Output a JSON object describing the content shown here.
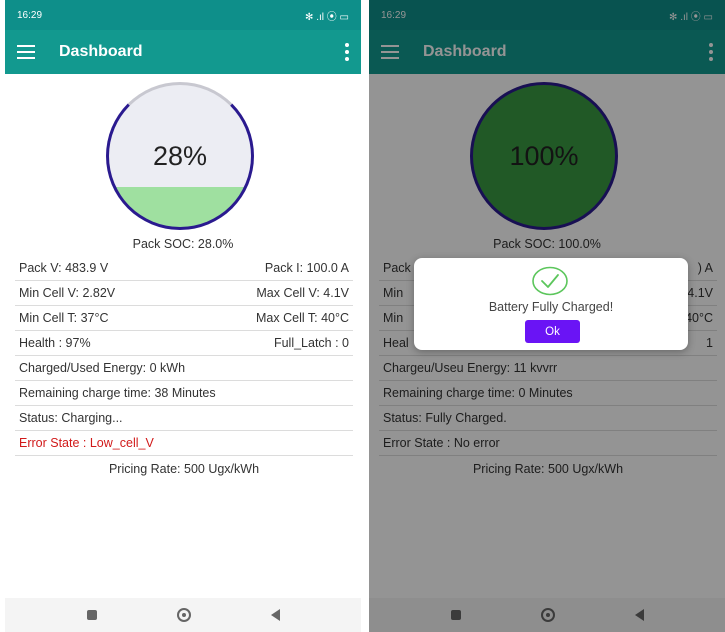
{
  "colors": {
    "toolbar": "#12998f",
    "gauge_fill_left": "#9fe0a0",
    "gauge_fill_right": "#3a9a43",
    "gauge_ring": "#2a1a8f",
    "dialog_button": "#6a14f5",
    "error_text": "#d11a1a"
  },
  "left": {
    "status": {
      "time": "16:29",
      "icons": "✻ .ıl ⦿ ▭"
    },
    "appbar": {
      "title": "Dashboard"
    },
    "gauge": {
      "text": "28%",
      "level": 0.28
    },
    "soc_label": "Pack SOC: 28.0%",
    "rows": [
      {
        "left": "Pack V: 483.9 V",
        "right": "Pack I: 100.0 A"
      },
      {
        "left": "Min Cell V: 2.82V",
        "right": "Max Cell V: 4.1V"
      },
      {
        "left": "Min Cell T: 37°C",
        "right": "Max Cell T: 40°C"
      },
      {
        "left": "Health : 97%",
        "right": "Full_Latch : 0"
      }
    ],
    "energy": "Charged/Used Energy: 0 kWh",
    "remaining": "Remaining charge time: 38 Minutes",
    "status_text": "Status: Charging...",
    "error_state": "Error State : Low_cell_V",
    "pricing": "Pricing Rate:  500 Ugx/kWh"
  },
  "right": {
    "status": {
      "time": "16:29",
      "icons": "✻ .ıl ⦿ ▭"
    },
    "appbar": {
      "title": "Dashboard"
    },
    "gauge": {
      "text": "100%",
      "level": 1.0
    },
    "soc_label": "Pack SOC: 100.0%",
    "rows": [
      {
        "left": "Pack",
        "right": ") A"
      },
      {
        "left": "Min",
        "right": "4.1V"
      },
      {
        "left": "Min",
        "right": "40°C"
      },
      {
        "left": "Heal",
        "right": "1"
      }
    ],
    "energy": "Chargeu/Useu Energy: 11 kvvrr",
    "remaining": "Remaining charge time: 0 Minutes",
    "status_text": "Status: Fully Charged.",
    "error_state": "Error State : No error",
    "pricing": "Pricing Rate:  500 Ugx/kWh",
    "dialog": {
      "message": "Battery Fully Charged!",
      "ok_label": "Ok"
    }
  }
}
